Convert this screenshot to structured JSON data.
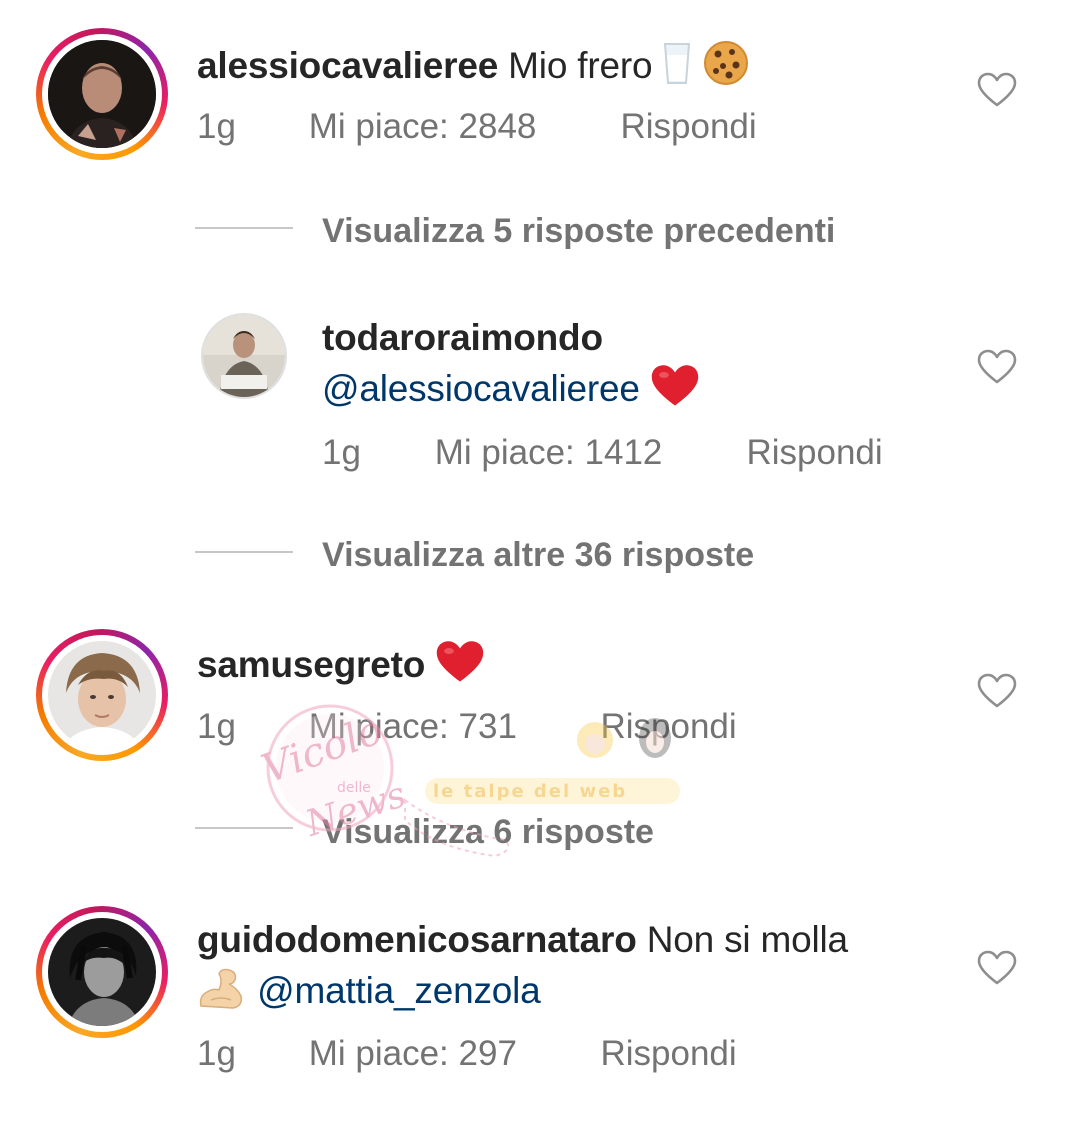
{
  "comments": [
    {
      "username": "alessiocavalieree",
      "text": "Mio frero",
      "time": "1g",
      "likes": "Mi piace: 2848",
      "reply_label": "Rispondi",
      "emoji_icons": [
        "milk-glass-icon",
        "cookie-icon"
      ]
    },
    {
      "username": "samusegreto",
      "text": "",
      "time": "1g",
      "likes": "Mi piace: 731",
      "reply_label": "Rispondi",
      "emoji_icons": [
        "red-heart-icon"
      ]
    },
    {
      "username": "guidodomenicosarnataro",
      "text": "Non si molla",
      "mention": "@mattia_zenzola",
      "time": "1g",
      "likes": "Mi piace: 297",
      "reply_label": "Rispondi",
      "emoji_icons": [
        "flexed-biceps-icon"
      ]
    }
  ],
  "replies": [
    {
      "username": "todaroraimondo",
      "mention": "@alessiocavalieree",
      "time": "1g",
      "likes": "Mi piace: 1412",
      "reply_label": "Rispondi",
      "emoji_icons": [
        "red-heart-icon"
      ]
    }
  ],
  "view_replies": {
    "previous": "Visualizza 5 risposte precedenti",
    "more": "Visualizza altre 36 risposte",
    "samusegreto": "Visualizza 6 risposte"
  },
  "watermark": {
    "script_text": "Vicolo",
    "small_text": "delle",
    "script_text2": "News",
    "banner_text": "le talpe del web"
  },
  "colors": {
    "text": "#262626",
    "secondary": "#737373",
    "mention": "#00376b",
    "heart_emoji": "#e0202e",
    "story_ring_start": "#f9a825",
    "story_ring_end": "#c2185b"
  }
}
